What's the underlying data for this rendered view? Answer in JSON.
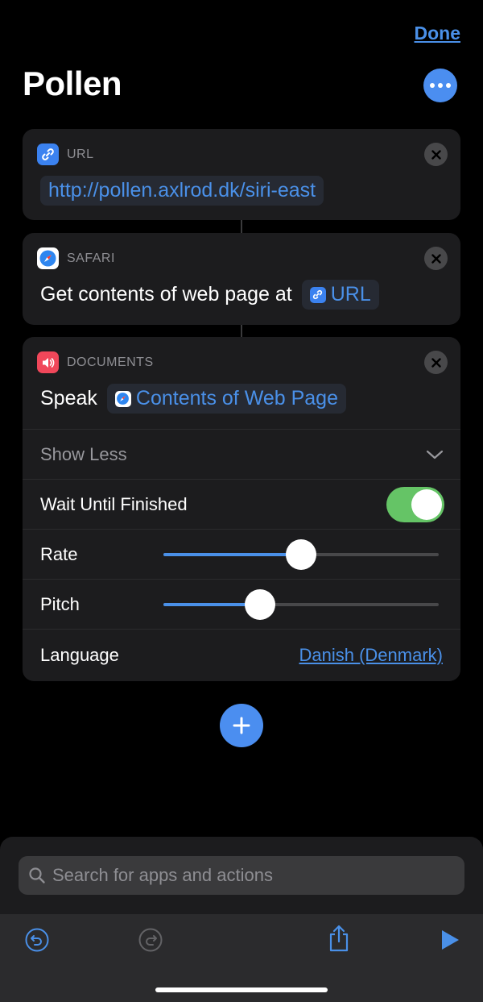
{
  "header": {
    "done_label": "Done",
    "title": "Pollen"
  },
  "actions": [
    {
      "app_label": "URL",
      "url_value": "http://pollen.axlrod.dk/siri-east"
    },
    {
      "app_label": "SAFARI",
      "text": "Get contents of web page at",
      "token": "URL"
    },
    {
      "app_label": "DOCUMENTS",
      "text": "Speak",
      "token": "Contents of Web Page",
      "show_less": "Show Less",
      "wait_label": "Wait Until Finished",
      "wait_on": true,
      "rate_label": "Rate",
      "rate_value": 0.5,
      "pitch_label": "Pitch",
      "pitch_value": 0.35,
      "language_label": "Language",
      "language_value": "Danish (Denmark)"
    }
  ],
  "search": {
    "placeholder": "Search for apps and actions"
  },
  "colors": {
    "accent": "#4a90e8",
    "toggle_on": "#65c466",
    "background": "#000000",
    "card": "#1c1c1e"
  },
  "icons": [
    "more-icon",
    "link-icon",
    "safari-compass-icon",
    "speaker-icon",
    "close-icon",
    "chevron-down-icon",
    "plus-icon",
    "search-icon",
    "undo-icon",
    "redo-icon",
    "share-icon",
    "play-icon"
  ]
}
